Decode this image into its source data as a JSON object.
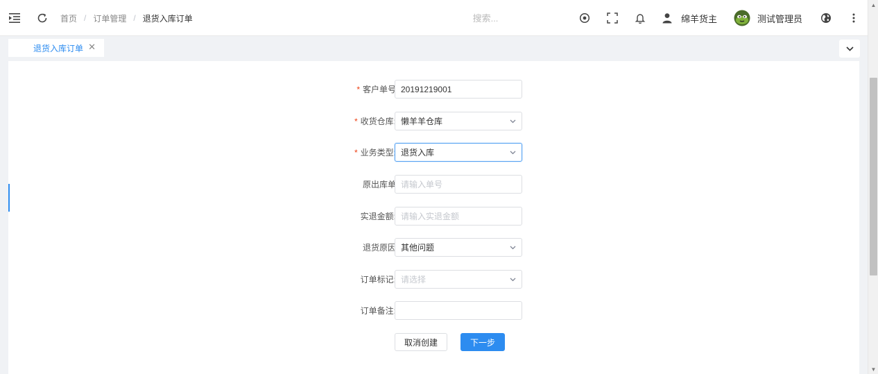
{
  "header": {
    "breadcrumb": [
      {
        "label": "首页"
      },
      {
        "label": "订单管理"
      },
      {
        "label": "退货入库订单"
      }
    ],
    "breadcrumb_separator": "/",
    "search_placeholder": "搜索...",
    "warehouse_owner": "绵羊货主",
    "admin_name": "测试管理员"
  },
  "tabs": {
    "active_label": "退货入库订单",
    "close_glyph": "✕"
  },
  "form": {
    "customer_order": {
      "label": "客户单号",
      "required": "*",
      "value": "20191219001"
    },
    "warehouse": {
      "label": "收货仓库:",
      "required": "*",
      "value": "懒羊羊仓库"
    },
    "business_type": {
      "label": "业务类型:",
      "required": "*",
      "value": "退货入库"
    },
    "original_outbound": {
      "label": "原出库单",
      "placeholder": "请输入单号"
    },
    "refund_amount": {
      "label": "实退金额:",
      "placeholder": "请输入实退金额"
    },
    "return_reason": {
      "label": "退货原因",
      "value": "其他问题"
    },
    "order_mark": {
      "label": "订单标记:",
      "placeholder": "请选择"
    },
    "order_note": {
      "label": "订单备注:",
      "value": ""
    },
    "cancel_label": "取消创建",
    "next_label": "下一步"
  },
  "colors": {
    "primary": "#2d8cf0",
    "required": "#ed4014"
  },
  "icons": {
    "menu_toggle": "menu-fold-icon",
    "refresh": "refresh-icon",
    "eye": "eye-icon",
    "fullscreen": "fullscreen-icon",
    "bell": "bell-icon",
    "user": "user-icon",
    "avatar": "avatar-icon",
    "globe": "globe-icon",
    "more": "more-vertical-icon"
  }
}
